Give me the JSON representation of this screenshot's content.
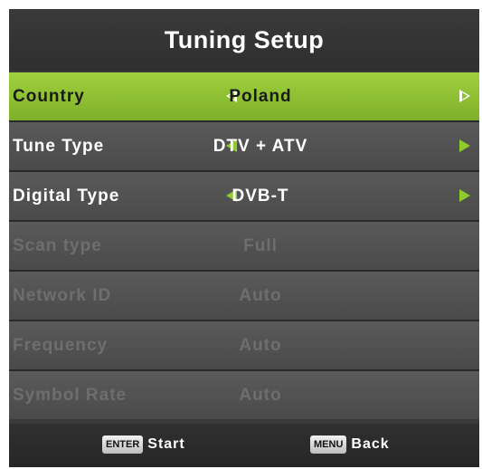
{
  "title": "Tuning Setup",
  "rows": [
    {
      "label": "Country",
      "value": "Poland"
    },
    {
      "label": "Tune Type",
      "value": "DTV + ATV"
    },
    {
      "label": "Digital Type",
      "value": "DVB-T"
    },
    {
      "label": "Scan type",
      "value": "Full"
    },
    {
      "label": "Network ID",
      "value": "Auto"
    },
    {
      "label": "Frequency",
      "value": "Auto"
    },
    {
      "label": "Symbol Rate",
      "value": "Auto"
    }
  ],
  "footer": {
    "enter_key": "ENTER",
    "enter_label": "Start",
    "menu_key": "MENU",
    "menu_label": "Back"
  },
  "colors": {
    "selected_row": "#8fc02f",
    "arrow": "#8fcc2c",
    "panel_background": "#3a3a3a",
    "row_background": "#555555",
    "disabled_text": "#6e6e6e"
  }
}
